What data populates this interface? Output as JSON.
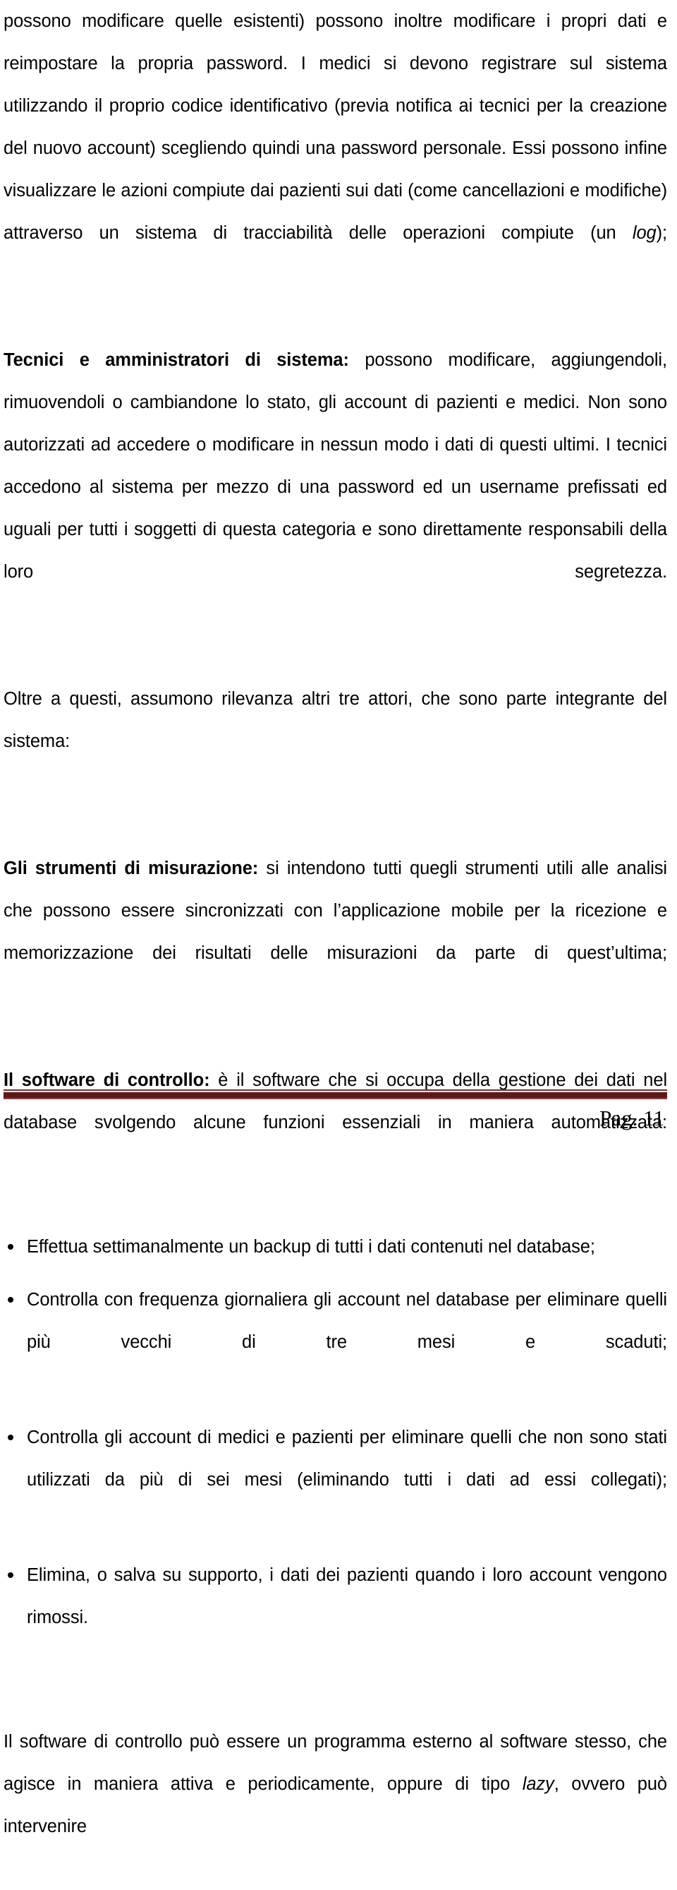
{
  "document": {
    "language": "it",
    "page_label": "Pag. 11",
    "footer_rule_color": "#5B1A19",
    "footer_rule_accent_color": "#7C2B2B",
    "body_text_color": "#000000",
    "background_color": "#ffffff"
  },
  "content": {
    "paragraph_1": {
      "text_part_1": "possono modificare quelle esistenti) possono inoltre modificare i propri dati e reimpostare la propria password. I medici si devono registrare sul sistema utilizzando il proprio codice identificativo (previa notifica ai tecnici per la creazione del nuovo account) scegliendo quindi una password personale. Essi possono infine visualizzare le azioni compiute dai pazienti sui dati (come cancellazioni e modifiche) attraverso un sistema di tracciabilità delle operazioni compiute (un ",
      "italic_term": "log",
      "text_part_2": ");"
    },
    "paragraph_2": {
      "lead_bold": "Tecnici e amministratori di sistema:",
      "body": " possono modificare, aggiungendoli, rimuovendoli o cambiandone lo stato, gli account di pazienti e medici. Non sono autorizzati ad accedere o modificare in nessun modo i dati di questi ultimi. I tecnici accedono al sistema per mezzo di una password ed un username prefissati ed uguali per tutti i soggetti di questa categoria e sono direttamente responsabili della loro segretezza."
    },
    "paragraph_3": {
      "text": "Oltre a questi, assumono rilevanza altri tre attori, che sono parte integrante del sistema:"
    },
    "paragraph_4": {
      "lead_bold": "Gli strumenti di misurazione:",
      "body": " si intendono tutti quegli strumenti utili alle analisi che possono essere sincronizzati con l’applicazione mobile per la ricezione e memorizzazione dei risultati delle misurazioni da parte di quest’ultima;"
    },
    "paragraph_5": {
      "lead_bold": "Il software di controllo:",
      "body": " è il software che si occupa della gestione dei dati nel database svolgendo alcune funzioni essenziali in maniera automatizzata:"
    },
    "bullet_list": [
      {
        "text": "Effettua settimanalmente un backup di tutti i dati contenuti nel database;"
      },
      {
        "text": "Controlla con frequenza giornaliera gli account nel database per eliminare quelli più vecchi di tre mesi e scaduti;"
      },
      {
        "text": "Controlla gli account di medici e pazienti per eliminare quelli che non sono stati utilizzati da più di sei mesi (eliminando tutti i dati ad essi collegati);"
      },
      {
        "text": "Elimina, o salva su supporto, i dati dei pazienti quando i loro account vengono rimossi."
      }
    ],
    "paragraph_6": {
      "text_part_1": "Il software di controllo può essere un programma esterno al software stesso, che agisce in maniera attiva e periodicamente, oppure di tipo ",
      "italic_term": "lazy",
      "text_part_2": ", ovvero può intervenire"
    }
  }
}
